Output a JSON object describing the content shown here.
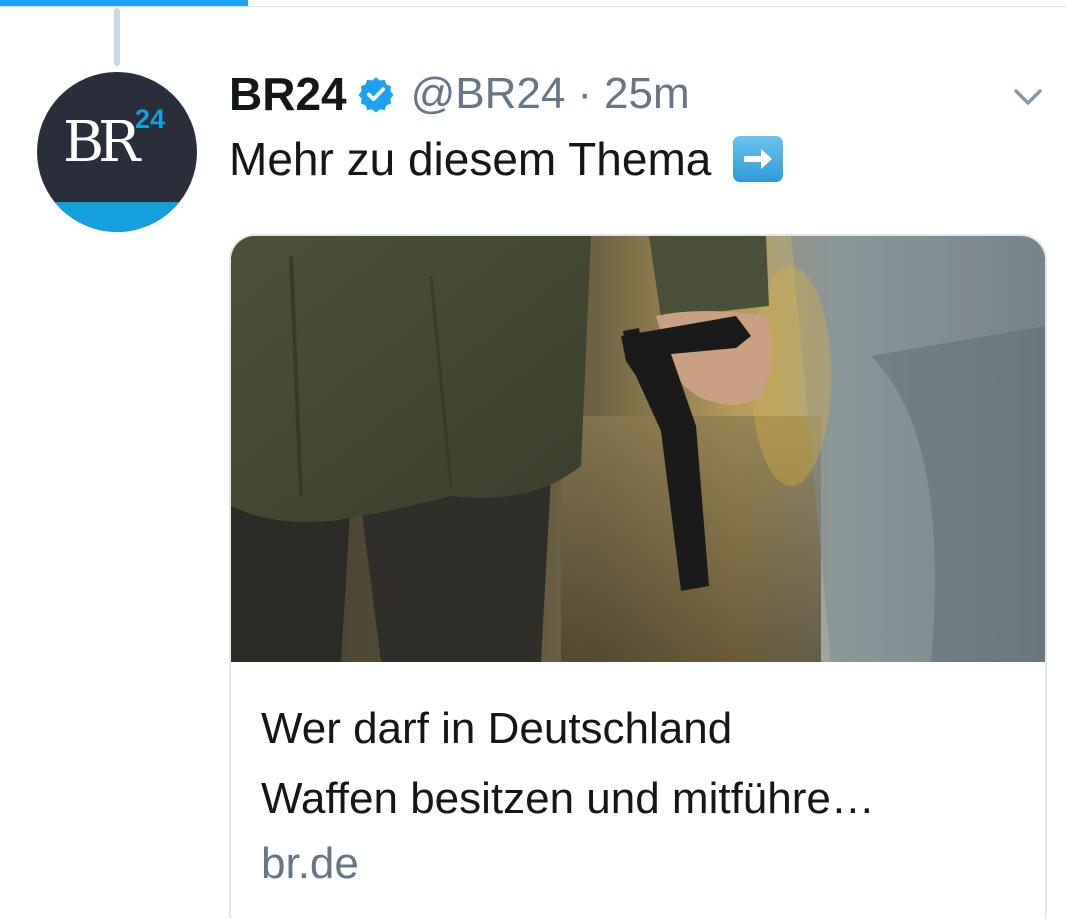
{
  "tweet": {
    "display_name": "BR24",
    "handle": "@BR24",
    "separator": "·",
    "time": "25m",
    "text": "Mehr zu diesem Thema",
    "emoji": "right-arrow-emoji"
  },
  "avatar": {
    "logo_letters": "BR",
    "logo_number": "24"
  },
  "card": {
    "title_line1": "Wer darf in Deutschland",
    "title_line2": "Waffen besitzen und mitführe…",
    "domain": "br.de"
  },
  "colors": {
    "accent": "#1da1f2",
    "secondary_text": "#657786",
    "primary_text": "#14171a",
    "border": "#e1e8ed",
    "brand_blue": "#14a0dc"
  },
  "icons": [
    "verified-icon",
    "chevron-down-icon",
    "right-arrow-emoji"
  ]
}
